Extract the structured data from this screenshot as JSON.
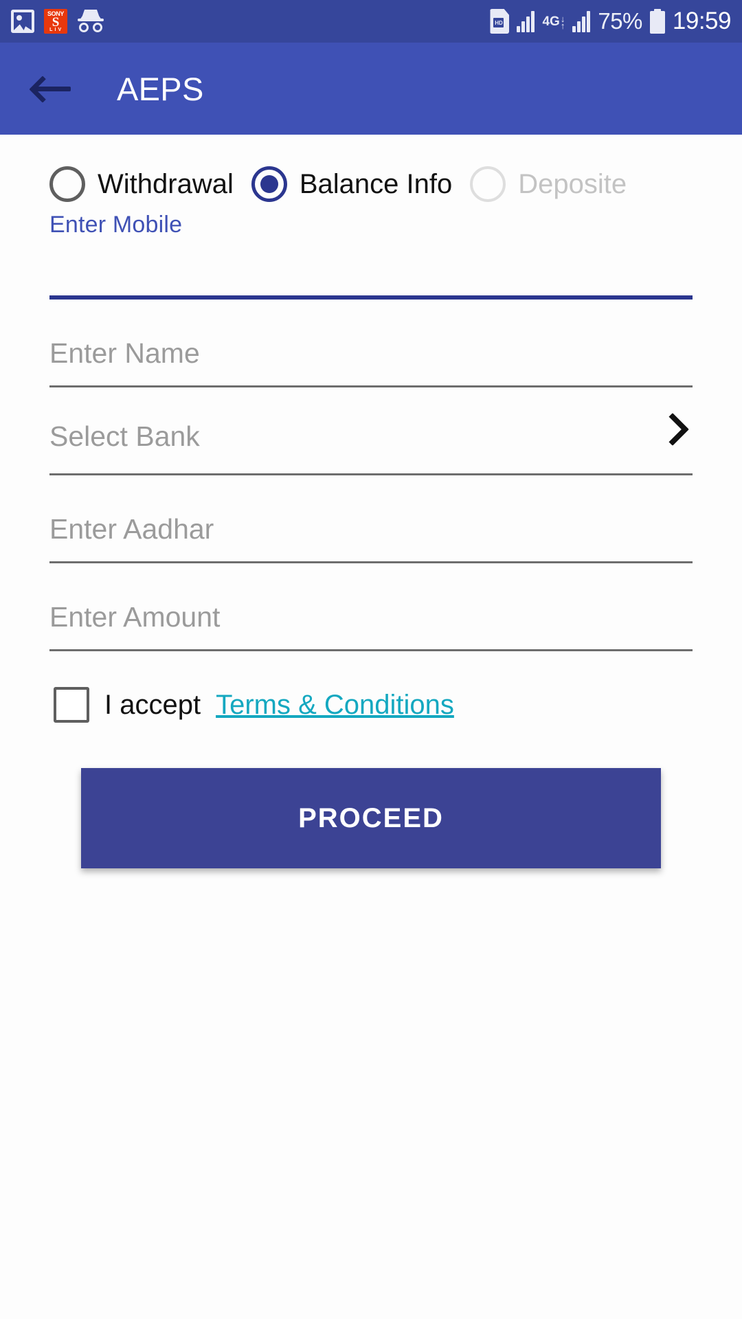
{
  "status_bar": {
    "background_color": "#36469b",
    "left_icons": [
      {
        "name": "photo-icon",
        "label": "Photo"
      },
      {
        "name": "sony-liv-icon",
        "label": "SONY LIV",
        "top": "SONY",
        "mid": "S",
        "bottom": "L I V",
        "color": "#e8380d"
      },
      {
        "name": "incognito-icon",
        "label": "Incognito"
      }
    ],
    "sim_label": "HD",
    "network_type": "4G",
    "battery_percent": "75%",
    "time": "19:59"
  },
  "app_bar": {
    "background_color": "#3f51b5",
    "back_label": "Back",
    "title": "AEPS"
  },
  "form": {
    "transaction_types": [
      {
        "label": "Withdrawal",
        "selected": false,
        "disabled": false
      },
      {
        "label": "Balance Info",
        "selected": true,
        "disabled": false
      },
      {
        "label": "Deposite",
        "selected": false,
        "disabled": true
      }
    ],
    "mobile": {
      "label": "Enter Mobile",
      "value": "",
      "placeholder": "",
      "focused": true,
      "underline_color": "#2b368f"
    },
    "name": {
      "placeholder": "Enter Name",
      "value": ""
    },
    "bank": {
      "placeholder": "Select Bank",
      "value": "",
      "chevron": "chevron-right-icon"
    },
    "aadhar": {
      "placeholder": "Enter Aadhar",
      "value": ""
    },
    "amount": {
      "placeholder": "Enter Amount",
      "value": ""
    },
    "terms": {
      "checked": false,
      "accept_text": "I accept",
      "link_text": "Terms & Conditions",
      "link_color": "#14a8c0"
    },
    "submit": {
      "label": "PROCEED",
      "background_color": "#3c4394"
    }
  }
}
